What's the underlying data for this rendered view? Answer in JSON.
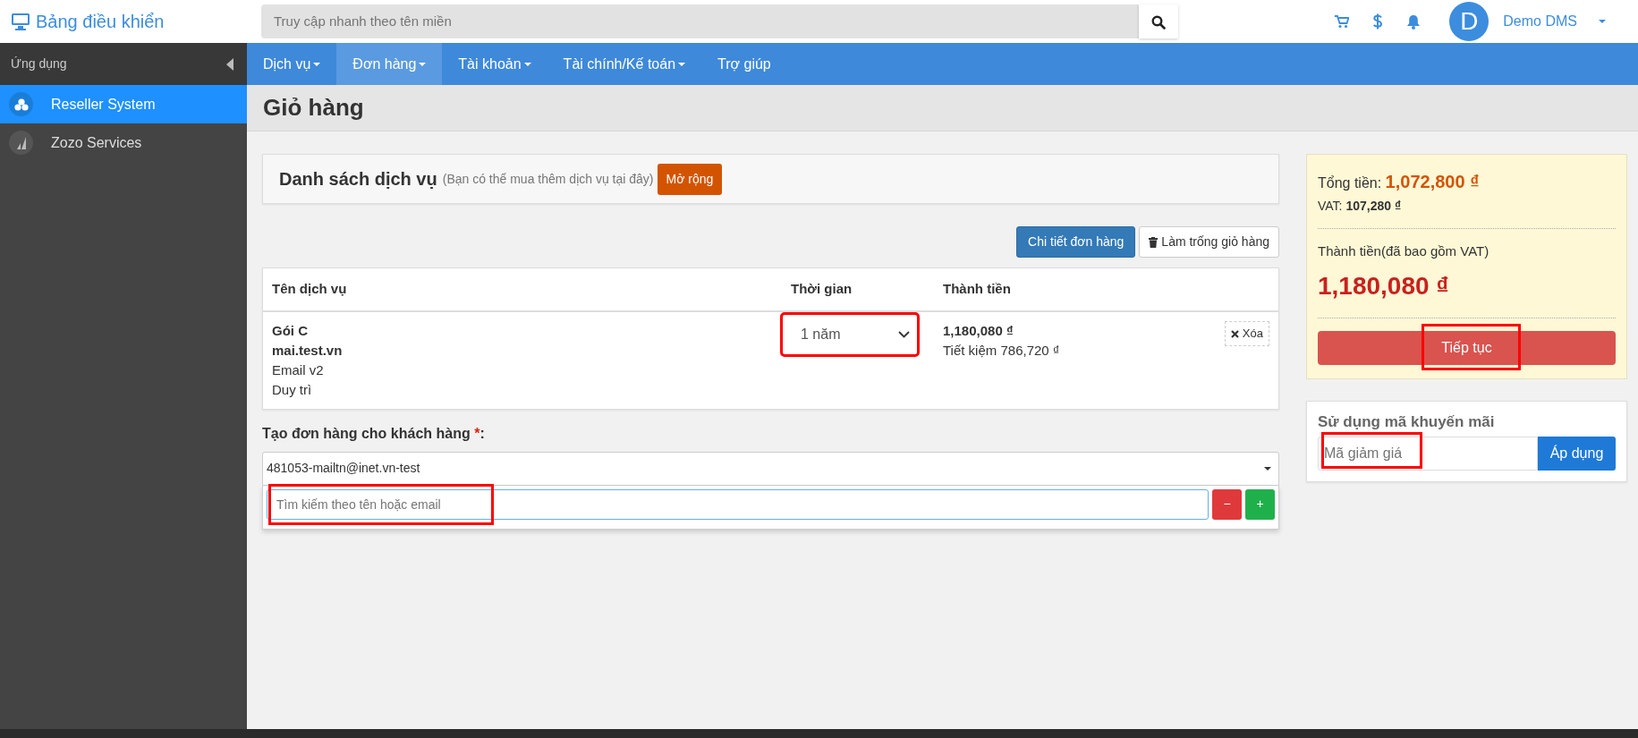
{
  "topbar": {
    "brand": "Bảng điều khiển",
    "search": {
      "placeholder": "Truy cập nhanh theo tên miền"
    },
    "user": {
      "avatar": "D",
      "name": "Demo DMS"
    }
  },
  "sidebar": {
    "header": "Ứng dụng",
    "items": [
      {
        "label": "Reseller System",
        "selected": true
      },
      {
        "label": "Zozo Services",
        "selected": false
      }
    ]
  },
  "menu": [
    {
      "label": "Dịch vụ",
      "dropdown": true,
      "selected": false
    },
    {
      "label": "Đơn hàng",
      "dropdown": true,
      "selected": true
    },
    {
      "label": "Tài khoản",
      "dropdown": true,
      "selected": false
    },
    {
      "label": "Tài chính/Kế toán",
      "dropdown": true,
      "selected": false
    },
    {
      "label": "Trợ giúp",
      "dropdown": false,
      "selected": false
    }
  ],
  "page_title": "Giỏ hàng",
  "services_card": {
    "title": "Danh sách dịch vụ",
    "note": "(Bạn có thể mua thêm dịch vụ tại đây)",
    "button": "Mở rộng"
  },
  "actions": [
    {
      "label": "Chi tiết đơn hàng",
      "kind": "primary"
    },
    {
      "label": "Làm trống giỏ hàng",
      "kind": "trash"
    }
  ],
  "table": {
    "columns": [
      "Tên dịch vụ",
      "Thời gian",
      "Thành tiền"
    ],
    "rows": [
      {
        "package": "Gói C",
        "domain": "mai.test.vn",
        "product": "Email v2",
        "type": "Duy trì",
        "period": "1 năm",
        "period_highlighted": true,
        "price": "1,180,080 ₫",
        "saving": "Tiết kiệm 786,720 ₫",
        "remove": "Xóa"
      }
    ]
  },
  "customer": {
    "label": "Tạo đơn hàng cho khách hàng",
    "required": "*",
    "suffix": ":",
    "selected_value": "481053-mailtn@inet.vn-test",
    "search": {
      "placeholder": "Tìm kiếm theo tên hoặc email",
      "highlighted": true
    },
    "minus": "−",
    "plus": "+"
  },
  "summary": {
    "total_label": "Tổng tiền:",
    "total": "1,072,800 ₫",
    "vat_label": "VAT:",
    "vat": "107,280 ₫",
    "grand_label": "Thành tiền(đã bao gồm VAT)",
    "grand": "1,180,080 ₫",
    "button": "Tiếp tục",
    "button_highlighted": true
  },
  "promo": {
    "title": "Sử dụng mã khuyến mãi",
    "field": {
      "placeholder": "Mã giảm giá",
      "highlighted": true
    },
    "button": "Áp dụng"
  }
}
